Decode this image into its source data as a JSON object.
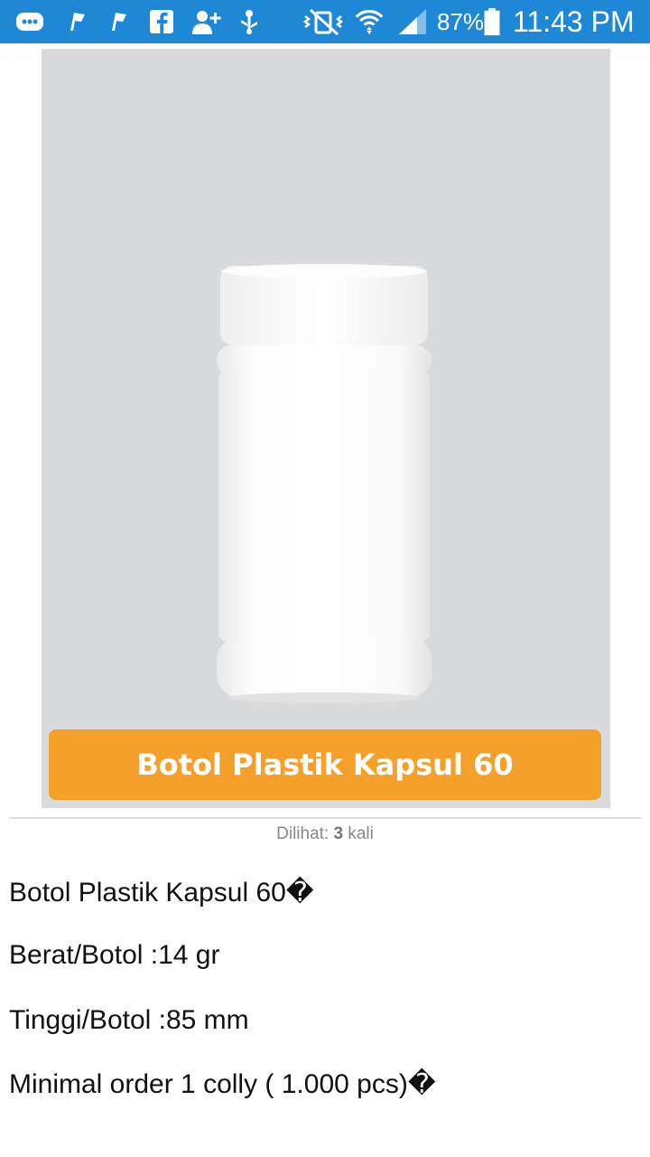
{
  "status_bar": {
    "background_color": "#1e88d6",
    "left_icons": [
      "chat-notification-icon",
      "flag-icon",
      "flag-icon",
      "facebook-icon",
      "add-friend-icon",
      "usb-debug-icon"
    ],
    "right_icons": [
      "mute-icon",
      "wifi-icon",
      "signal-icon",
      "battery-icon"
    ],
    "battery_percent": "87%",
    "time": "11:43 PM"
  },
  "product": {
    "banner_text": "Botol Plastik Kapsul 60",
    "banner_color": "#f5a02a",
    "image_background": "#d9dadc"
  },
  "views": {
    "label": "Dilihat:",
    "count": "3",
    "suffix": "kali"
  },
  "details": {
    "name": "Botol Plastik Kapsul 60�",
    "weight": "Berat/Botol :14 gr",
    "height": "Tinggi/Botol :85 mm",
    "min_order": "Minimal order 1 colly ( 1.000 pcs)�"
  }
}
